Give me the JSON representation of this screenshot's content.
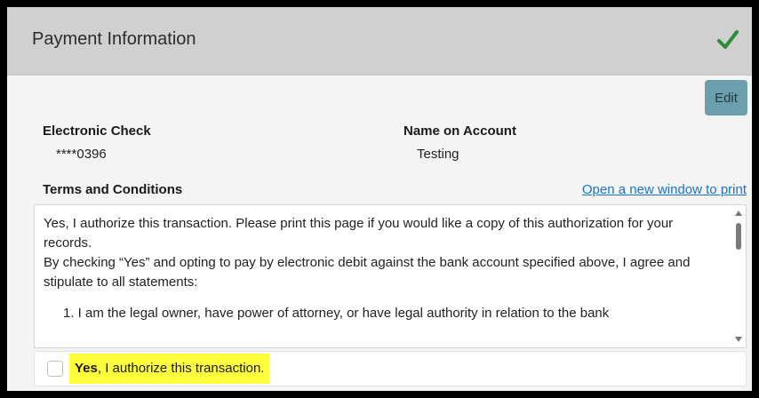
{
  "header": {
    "title": "Payment Information",
    "status_icon": "checkmark-icon",
    "status_color": "#2e8b3a"
  },
  "actions": {
    "edit_label": "Edit"
  },
  "payment_method": {
    "label": "Electronic Check",
    "value": "****0396"
  },
  "account_name": {
    "label": "Name on Account",
    "value": "Testing"
  },
  "terms": {
    "heading": "Terms and Conditions",
    "print_link": "Open a new window to print",
    "paragraph_1": "Yes, I authorize this transaction. Please print this page if you would like a copy of this authorization for your records.",
    "paragraph_2": "By checking “Yes” and opting to pay by electronic debit against the bank account specified above, I agree and stipulate to all statements:",
    "item_1": "1. I am the legal owner, have power of attorney, or have legal authority in relation to the bank"
  },
  "consent": {
    "bold": "Yes",
    "text": ", I authorize this transaction.",
    "checked": false,
    "highlight_color": "#ffff3b"
  },
  "colors": {
    "edit_button": "#6c9fae",
    "link": "#1a73c8",
    "header_bg": "#d0d0d0"
  }
}
